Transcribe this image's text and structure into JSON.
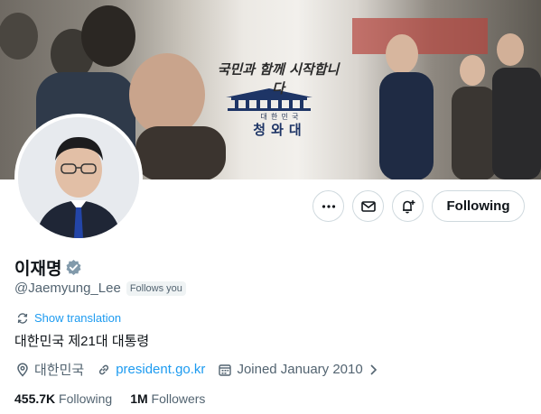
{
  "banner": {
    "caption": "국민과 함께 시작합니다",
    "sub_small": "대 한 민 국",
    "sub_large": "청와대"
  },
  "profile": {
    "name": "이재명",
    "handle": "@Jaemyung_Lee",
    "follows_you": "Follows you",
    "show_translation": "Show translation",
    "bio": "대한민국 제21대 대통령",
    "location": "대한민국",
    "website": "president.go.kr",
    "joined": "Joined January 2010"
  },
  "actions": {
    "following_label": "Following"
  },
  "stats": {
    "following_count": "455.7K",
    "following_label": "Following",
    "followers_count": "1M",
    "followers_label": "Followers"
  },
  "colors": {
    "accent": "#1d9bf0",
    "verified": "#829aab",
    "secondary_text": "#536471"
  }
}
